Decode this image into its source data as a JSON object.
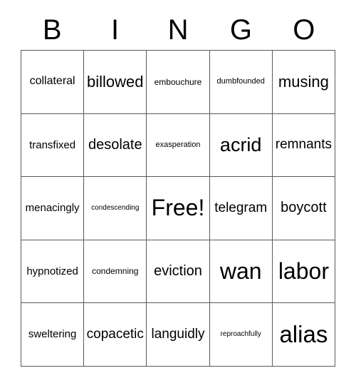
{
  "card": {
    "title": "Bingo Card",
    "header_letters": [
      "B",
      "I",
      "N",
      "G",
      "O"
    ],
    "background_color": "#ffffff",
    "border_color": "#595959",
    "text_color": "#000000",
    "grid_size": "5x5",
    "free_space_label": "Free!",
    "free_space_position": "row3-col3",
    "rows": [
      {
        "cells": [
          {
            "label": "collateral",
            "size": "fs-s"
          },
          {
            "label": "billowed",
            "size": "fs-ml"
          },
          {
            "label": "embouchure",
            "size": "fs-xxs"
          },
          {
            "label": "dumbfounded",
            "size": "fs-xxxs"
          },
          {
            "label": "musing",
            "size": "fs-ml"
          }
        ]
      },
      {
        "cells": [
          {
            "label": "transfixed",
            "size": "fs-xs"
          },
          {
            "label": "desolate",
            "size": "fs-m"
          },
          {
            "label": "exasperation",
            "size": "fs-xxxs"
          },
          {
            "label": "acrid",
            "size": "fs-l"
          },
          {
            "label": "remnants",
            "size": "fs-ms"
          }
        ]
      },
      {
        "cells": [
          {
            "label": "menacingly",
            "size": "fs-xs"
          },
          {
            "label": "condescending",
            "size": "fs-tiny"
          },
          {
            "label": "Free!",
            "size": "fs-xl"
          },
          {
            "label": "telegram",
            "size": "fs-ms"
          },
          {
            "label": "boycott",
            "size": "fs-m"
          }
        ]
      },
      {
        "cells": [
          {
            "label": "hypnotized",
            "size": "fs-xs"
          },
          {
            "label": "condemning",
            "size": "fs-xxs"
          },
          {
            "label": "eviction",
            "size": "fs-m"
          },
          {
            "label": "wan",
            "size": "fs-xl"
          },
          {
            "label": "labor",
            "size": "fs-xl"
          }
        ]
      },
      {
        "cells": [
          {
            "label": "sweltering",
            "size": "fs-xs"
          },
          {
            "label": "copacetic",
            "size": "fs-ms"
          },
          {
            "label": "languidly",
            "size": "fs-ms"
          },
          {
            "label": "reproachfully",
            "size": "fs-tiny"
          },
          {
            "label": "alias",
            "size": "fs-xxl"
          }
        ]
      }
    ]
  }
}
